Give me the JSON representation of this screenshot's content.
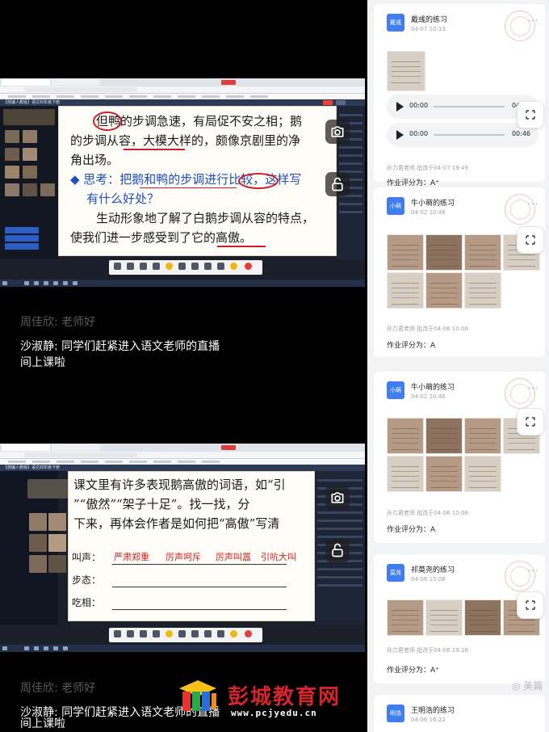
{
  "stream1": {
    "app_name": "【部编人教版】语文四年级下册",
    "slide_lines": [
      "但鸭的步调急速，有局促不安之相；鹅",
      "的步调从容，大模大样的，颇像京剧里的净",
      "角出场。",
      "◆ 思考：把鹅和鸭的步调进行比较，这样写",
      "有什么好处？",
      "生动形象地了解了白鹅步调从容的特点，",
      "使我们进一步感受到了它的高傲。"
    ],
    "chat": [
      {
        "user": "周佳欣:",
        "text": "老师好"
      },
      {
        "user": "沙淑静:",
        "text": "同学们赶紧进入语文老师的直播",
        "cont": "间上课啦"
      }
    ]
  },
  "stream2": {
    "app_name": "【部编人教版】语文四年级下册",
    "slide_lines": [
      "课文里有许多表现鹅高傲的词语，如“引",
      "”“傲然”“架子十足”。找一找，分",
      "下来，再体会作者是如何把“高傲”写清"
    ],
    "rows": [
      {
        "label": "叫声：",
        "answers": [
          "严肃郑重",
          "厉声呵斥",
          "厉声叫嚣",
          "引吭大叫"
        ]
      },
      {
        "label": "步态：",
        "answers": []
      },
      {
        "label": "吃相：",
        "answers": []
      }
    ],
    "chat": [
      {
        "user": "周佳欣:",
        "text": "老师好"
      },
      {
        "user": "沙淑静:",
        "text": "同学们赶紧进入语文老师的直播",
        "cont": "间上课啦"
      }
    ]
  },
  "feed": {
    "cards": [
      {
        "avatar": "戴彧",
        "name": "戴彧的练习",
        "date": "04-07 10:13",
        "audio": [
          {
            "start": "00:00",
            "end": "04:50"
          },
          {
            "start": "00:00",
            "end": "00:46"
          }
        ],
        "review": "孙力君老师 批改于04-07 19:49",
        "score": "作业评分为：A⁺"
      },
      {
        "avatar": "小萌",
        "name": "牛小萌的练习",
        "date": "04-02 10:46",
        "review": "孙力君老师 批改于04-06 10:08",
        "score": "作业评分为：A"
      },
      {
        "avatar": "小萌",
        "name": "牛小萌的练习",
        "date": "04-02 10:46",
        "review": "孙力君老师 批改于04-06 10:08",
        "score": "作业评分为：A"
      },
      {
        "avatar": "莫尧",
        "name": "祁莫尧的练习",
        "date": "04-06 15:08",
        "review": "孙力君老师 批改于04-06 19:16",
        "score": "作业评分为：A⁺"
      },
      {
        "avatar": "明浩",
        "name": "王明浩的练习",
        "date": "04-06 16:22"
      }
    ]
  },
  "watermarks": {
    "site": "彭城教育网",
    "url": "www.pcjyedu.cn",
    "meipian": "美篇"
  },
  "colors": {
    "accent_blue": "#3f7df0",
    "annotation_red": "#cc1e2c",
    "slide_blue": "#1d4fbf",
    "watermark_red": "#d6262b"
  },
  "icons": {
    "camera": "camera-icon",
    "lock": "unlock-icon",
    "side": "screenshot-icon"
  }
}
